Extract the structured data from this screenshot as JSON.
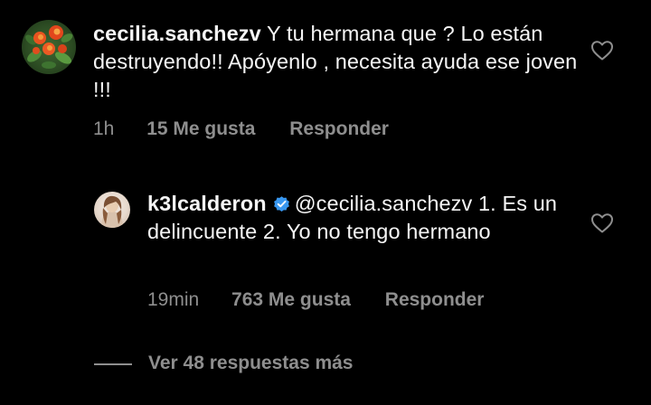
{
  "comments": [
    {
      "username": "cecilia.sanchezv",
      "text": "Y tu hermana que ? Lo están destruyendo!! Apóyenlo , necesita ayuda ese joven !!!",
      "time": "1h",
      "likes": "15 Me gusta",
      "reply_label": "Responder",
      "avatar_icon": "flowers-avatar"
    },
    {
      "username": "k3lcalderon",
      "verified": true,
      "text": "@cecilia.sanchezv 1. Es un delincuente 2. Yo no tengo hermano",
      "time": "19min",
      "likes": "763 Me gusta",
      "reply_label": "Responder",
      "avatar_icon": "profile-photo-avatar"
    }
  ],
  "view_more_label": "Ver 48 respuestas más",
  "colors": {
    "background": "#000000",
    "text": "#f5f5f5",
    "muted": "#8e8e8e",
    "verified": "#3897f0"
  }
}
